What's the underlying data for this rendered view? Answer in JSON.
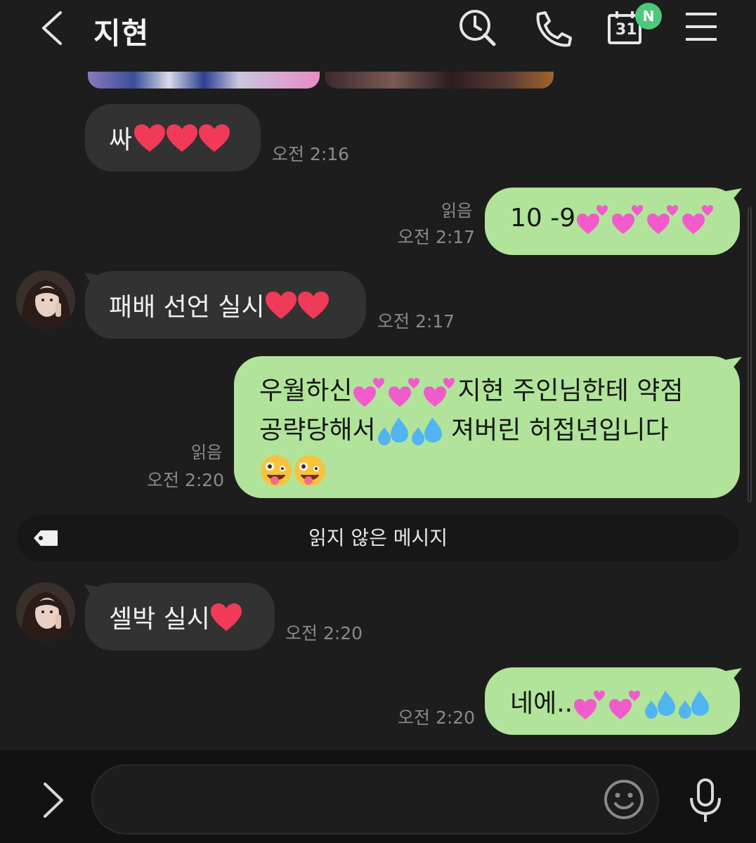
{
  "header": {
    "title": "지현",
    "calendar_day": "31",
    "new_badge": "N"
  },
  "messages": [
    {
      "from": "them",
      "text": "싸",
      "hearts": 3,
      "time": "오전 2:16"
    },
    {
      "from": "me",
      "text": "10 -9",
      "pink_hearts": 4,
      "read": "읽음",
      "time": "오전 2:17"
    },
    {
      "from": "them",
      "text": "패배 선언 실시",
      "hearts": 2,
      "time": "오전 2:17"
    },
    {
      "from": "me",
      "line1a": "우월하신",
      "line1b": "지현 주인님한테 약점",
      "line2a": "공략당해서",
      "line2b": " 져버린 허접년입니다",
      "read": "읽음",
      "time": "오전 2:20"
    },
    {
      "from": "them",
      "text": "셀박 실시",
      "hearts": 1,
      "time": "오전 2:20"
    },
    {
      "from": "me",
      "text": "네에..",
      "time": "오전 2:20"
    }
  ],
  "divider": {
    "label": "읽지 않은 메시지"
  },
  "colors": {
    "background": "#1d1d1d",
    "incoming_bubble": "#323232",
    "outgoing_bubble": "#b1e49a",
    "badge_green": "#4cc97a"
  },
  "icons": [
    "back-icon",
    "search-icon",
    "phone-icon",
    "calendar-icon",
    "menu-icon",
    "tag-icon",
    "expand-icon",
    "emoji-icon",
    "mic-icon"
  ]
}
